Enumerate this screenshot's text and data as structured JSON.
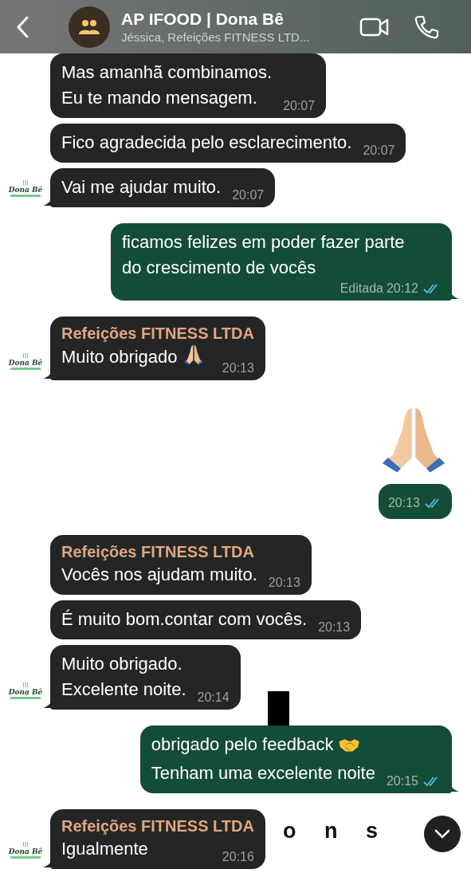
{
  "header": {
    "title": "AP IFOOD | Dona Bê",
    "subtitle": "Jéssica, Refeições FITNESS LTD..."
  },
  "wallpaper": {
    "text": "o n s"
  },
  "messages": [
    {
      "kind": "incoming",
      "text": "Mas amanhã combinamos.\nEu te mando mensagem.",
      "time": "20:07",
      "tail": false
    },
    {
      "kind": "incoming",
      "text": "Fico agradecida pelo esclarecimento.",
      "time": "20:07",
      "tail": false
    },
    {
      "kind": "incoming",
      "text": "Vai me ajudar muito.",
      "time": "20:07",
      "tail": true,
      "avatar": "Dona Bê"
    },
    {
      "kind": "outgoing",
      "text": "ficamos felizes em poder fazer parte\ndo crescimento de vocês",
      "edited": "Editada",
      "time": "20:12",
      "read": true,
      "tail": true
    },
    {
      "kind": "incoming",
      "sender": "Refeições FITNESS LTDA",
      "text": "Muito obrigado",
      "emoji": {
        "kind": "praying-hands"
      },
      "time": "20:13",
      "tail": true,
      "avatar": "Dona Bê"
    },
    {
      "kind": "outgoing-jumbo",
      "emoji": {
        "kind": "praying-hands"
      },
      "time": "20:13",
      "read": true,
      "tail": false
    },
    {
      "kind": "incoming",
      "sender": "Refeições FITNESS LTDA",
      "text": "Vocês nos ajudam muito.",
      "time": "20:13",
      "tail": false
    },
    {
      "kind": "incoming",
      "text": "É muito bom.contar com vocês.",
      "time": "20:13",
      "tail": false
    },
    {
      "kind": "incoming",
      "text": "Muito obrigado.\nExcelente noite.",
      "time": "20:14",
      "tail": true,
      "avatar": "Dona Bê"
    },
    {
      "kind": "outgoing",
      "text": "obrigado pelo feedback",
      "emoji": {
        "kind": "handshake"
      },
      "text2": "Tenham uma excelente noite",
      "time": "20:15",
      "read": true,
      "tail": true
    },
    {
      "kind": "incoming",
      "sender": "Refeições FITNESS LTDA",
      "text": "Igualmente",
      "time": "20:16",
      "tail": true,
      "avatar": "Dona Bê"
    }
  ]
}
